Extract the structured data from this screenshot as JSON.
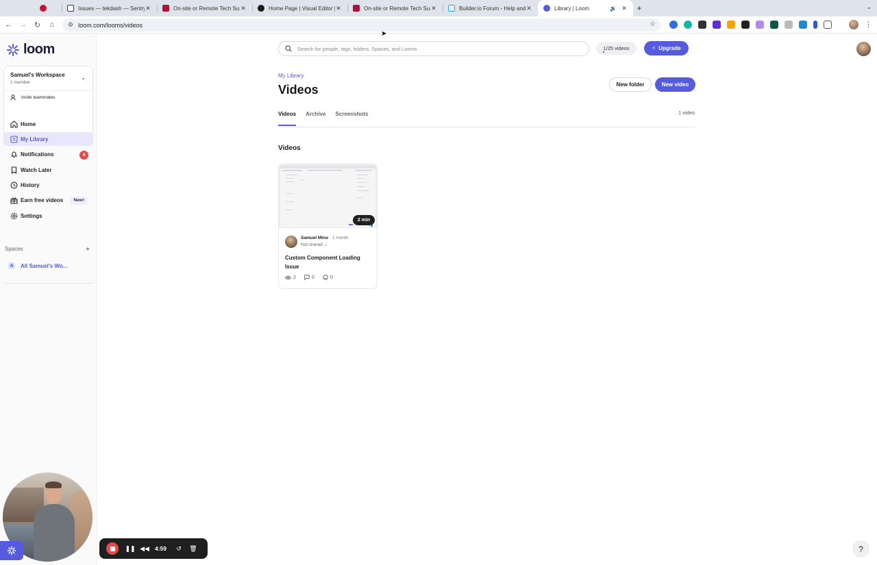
{
  "browser": {
    "tabs": [
      {
        "title": "",
        "favicon_color": "#c8102e"
      },
      {
        "title": "Issues — tekdash — Sentry",
        "favicon_color": "#362d59"
      },
      {
        "title": "On-site or Remote Tech Supp",
        "favicon_color": "#b1133a"
      },
      {
        "title": "Home Page | Visual Editor | B",
        "favicon_color": "#1a1a1a"
      },
      {
        "title": "On-site or Remote Tech Supp",
        "favicon_color": "#b1133a"
      },
      {
        "title": "Builder.io Forum - Help and",
        "favicon_color": "#2ea3f2"
      },
      {
        "title": "Library | Loom",
        "favicon_color": "#565add",
        "active": true
      }
    ],
    "url": "loom.com/looms/videos"
  },
  "sidebar": {
    "brand": "loom",
    "workspace": {
      "name": "Samuel's Workspace",
      "members": "1 member",
      "invite": "Invite teammates"
    },
    "nav": [
      {
        "label": "Home",
        "icon": "home-icon"
      },
      {
        "label": "My Library",
        "icon": "library-icon",
        "active": true
      },
      {
        "label": "Notifications",
        "icon": "bell-icon",
        "badge": "4"
      },
      {
        "label": "Watch Later",
        "icon": "bookmark-icon"
      },
      {
        "label": "History",
        "icon": "clock-icon"
      },
      {
        "label": "Earn free videos",
        "icon": "gift-icon",
        "tag": "New!"
      },
      {
        "label": "Settings",
        "icon": "gear-icon"
      }
    ],
    "spaces": {
      "heading": "Spaces",
      "add": "+",
      "items": [
        {
          "letter": "A",
          "label": "All Samuel's Wo..."
        }
      ]
    }
  },
  "header": {
    "search_placeholder": "Search for people, tags, folders, Spaces, and Looms",
    "quota": "1/25 videos",
    "upgrade": "Upgrade"
  },
  "main": {
    "breadcrumb": "My Library",
    "title": "Videos",
    "new_folder": "New folder",
    "new_video": "New video",
    "tabs": [
      "Videos",
      "Archive",
      "Screenshots"
    ],
    "count": "1 video",
    "section": "Videos",
    "video": {
      "duration": "2 min",
      "author": "Samuel Mino",
      "when": "· 1 month",
      "sharing": "Not shared",
      "title": "Custom Component Loading Issue",
      "views": "2",
      "comments": "0",
      "reactions": "0"
    }
  },
  "recorder": {
    "timer": "4:59"
  },
  "help": "?",
  "colors": {
    "accent": "#565add",
    "badge": "#e5484d",
    "recorder_bg": "#1f1f1f"
  }
}
